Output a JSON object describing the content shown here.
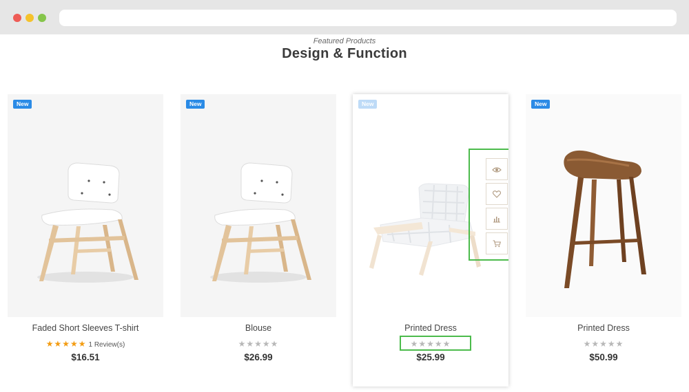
{
  "header": {
    "subtitle": "Featured Products",
    "title": "Design & Function"
  },
  "products": [
    {
      "name": "Faded Short Sleeves T-shirt",
      "badge": "New",
      "price": "$16.51",
      "rating": 5,
      "reviews": "1 Review(s)",
      "stars": "★★★★★"
    },
    {
      "name": "Blouse",
      "badge": "New",
      "price": "$26.99",
      "rating": 0,
      "stars": "★★★★★"
    },
    {
      "name": "Printed Dress",
      "badge": "New",
      "price": "$25.99",
      "rating": 0,
      "stars": "★★★★★"
    },
    {
      "name": "Printed Dress",
      "badge": "New",
      "price": "$50.99",
      "rating": 0,
      "stars": "★★★★★"
    }
  ],
  "hover_actions": {
    "quick_view_icon": "eye-icon",
    "wishlist_icon": "heart-icon",
    "compare_icon": "bar-chart-icon",
    "cart_icon": "cart-icon"
  },
  "colors": {
    "badge": "#2b8be6",
    "star_active": "#f39c12",
    "star_inactive": "#b8b8b8",
    "highlight": "#4bbb4b"
  }
}
